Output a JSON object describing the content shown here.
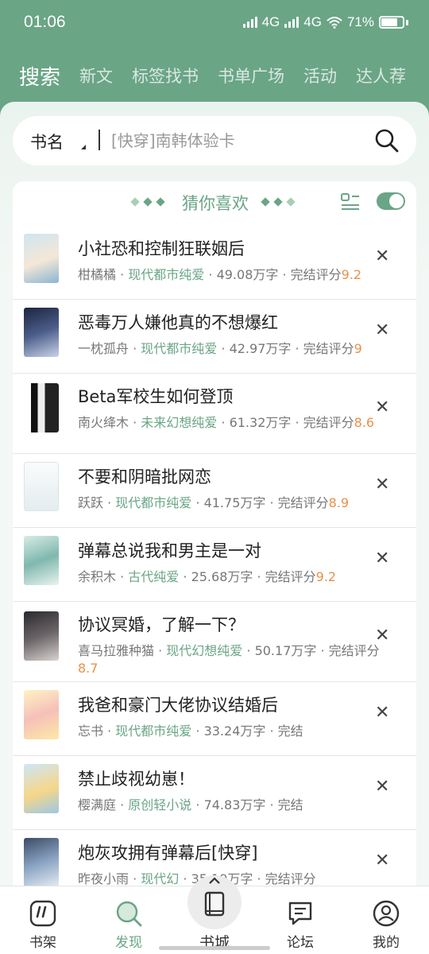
{
  "status": {
    "time": "01:06",
    "net1": "4G",
    "net2": "4G",
    "battery": "71%"
  },
  "tabs": [
    {
      "label": "搜索",
      "active": true
    },
    {
      "label": "新文"
    },
    {
      "label": "标签找书"
    },
    {
      "label": "书单广场"
    },
    {
      "label": "活动"
    },
    {
      "label": "达人荐"
    }
  ],
  "search": {
    "type_label": "书名",
    "placeholder": "[快穿]南韩体验卡"
  },
  "recommend": {
    "title": "猜你喜欢"
  },
  "books": [
    {
      "title": "小社恐和控制狂联姻后",
      "author": "柑橘橘",
      "tag": "现代都市纯爱",
      "words": "49.08万字",
      "status": "完结评分",
      "score": "9.2"
    },
    {
      "title": "恶毒万人嫌他真的不想爆红",
      "author": "一枕孤舟",
      "tag": "现代都市纯爱",
      "words": "42.97万字",
      "status": "完结评分",
      "score": "9"
    },
    {
      "title": "Beta军校生如何登顶",
      "author": "南火绛木",
      "tag": "未来幻想纯爱",
      "words": "61.32万字",
      "status": "完结评分",
      "score": "8.6"
    },
    {
      "title": "不要和阴暗批网恋",
      "author": "跃跃",
      "tag": "现代都市纯爱",
      "words": "41.75万字",
      "status": "完结评分",
      "score": "8.9"
    },
    {
      "title": "弹幕总说我和男主是一对",
      "author": "余积木",
      "tag": "古代纯爱",
      "words": "25.68万字",
      "status": "完结评分",
      "score": "9.2"
    },
    {
      "title": "协议冥婚，了解一下？",
      "author": "喜马拉雅种猫",
      "tag": "现代幻想纯爱",
      "words": "50.17万字",
      "status": "完结评分",
      "score": "8.7"
    },
    {
      "title": "我爸和豪门大佬协议结婚后",
      "author": "忘书",
      "tag": "现代都市纯爱",
      "words": "33.24万字",
      "status": "完结",
      "score": ""
    },
    {
      "title": "禁止歧视幼崽！",
      "author": "樱满庭",
      "tag": "原创轻小说",
      "words": "74.83万字",
      "status": "完结",
      "score": ""
    },
    {
      "title": "炮灰攻拥有弹幕后[快穿]",
      "author": "昨夜小雨",
      "tag": "现代幻",
      "words": "35.19万字",
      "status": "完结评分",
      "score": ""
    }
  ],
  "nav": {
    "shelf": "书架",
    "discover": "发现",
    "store": "书城",
    "forum": "论坛",
    "me": "我的"
  },
  "colors": {
    "brand": "#6aa586",
    "score": "#e8914a"
  }
}
